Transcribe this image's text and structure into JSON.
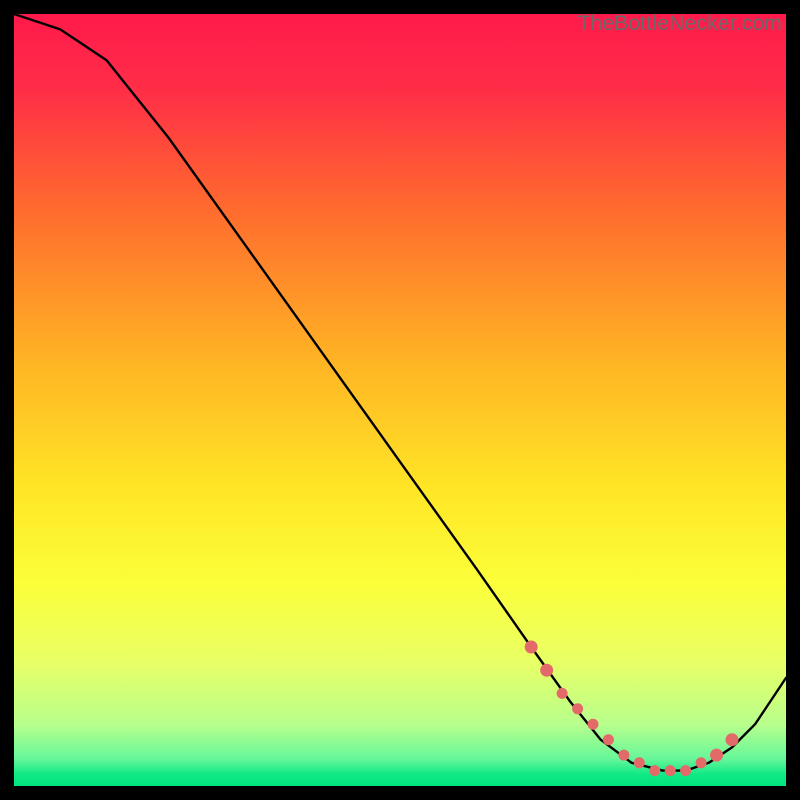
{
  "watermark": "TheBottleNecker.com",
  "gradient": {
    "stops": [
      {
        "offset": 0.0,
        "color": "#ff1a4b"
      },
      {
        "offset": 0.1,
        "color": "#ff2e47"
      },
      {
        "offset": 0.25,
        "color": "#ff6a2e"
      },
      {
        "offset": 0.45,
        "color": "#ffb424"
      },
      {
        "offset": 0.62,
        "color": "#ffe726"
      },
      {
        "offset": 0.74,
        "color": "#fbff3a"
      },
      {
        "offset": 0.84,
        "color": "#e8ff66"
      },
      {
        "offset": 0.92,
        "color": "#b8ff8c"
      },
      {
        "offset": 0.965,
        "color": "#66f79a"
      },
      {
        "offset": 0.985,
        "color": "#10e886"
      },
      {
        "offset": 1.0,
        "color": "#00e57d"
      }
    ]
  },
  "chart_data": {
    "type": "line",
    "title": "",
    "xlabel": "",
    "ylabel": "",
    "xlim": [
      0,
      100
    ],
    "ylim": [
      0,
      100
    ],
    "series": [
      {
        "name": "bottleneck-curve",
        "x": [
          0,
          6,
          12,
          20,
          30,
          40,
          50,
          60,
          67,
          72,
          76,
          80,
          84,
          87,
          90,
          93,
          96,
          100
        ],
        "values": [
          100,
          98,
          94,
          84,
          70,
          56,
          42,
          28,
          18,
          11,
          6,
          3,
          2,
          2,
          3,
          5,
          8,
          14
        ]
      }
    ],
    "markers": {
      "name": "highlight-dots",
      "x": [
        67,
        69,
        71,
        73,
        75,
        77,
        79,
        81,
        83,
        85,
        87,
        89,
        91,
        93
      ],
      "values": [
        18,
        15,
        12,
        10,
        8,
        6,
        4,
        3,
        2,
        2,
        2,
        3,
        4,
        6
      ]
    }
  }
}
